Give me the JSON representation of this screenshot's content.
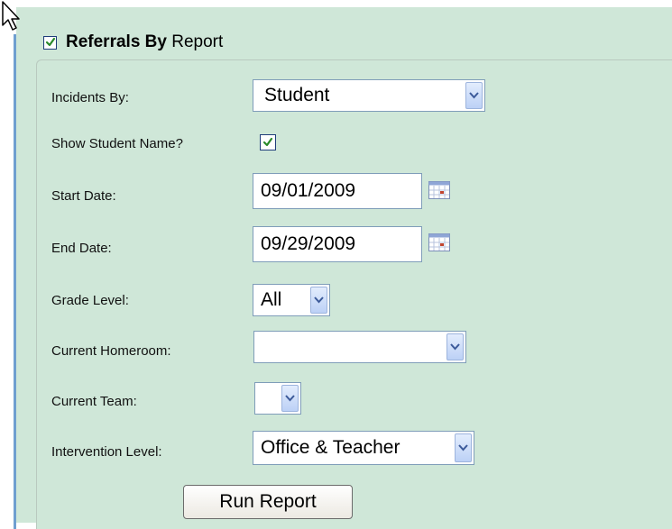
{
  "header": {
    "title_bold": "Referrals By",
    "title_rest": " Report",
    "enabled": true
  },
  "form": {
    "incidents_by": {
      "label": "Incidents By:",
      "value": "Student"
    },
    "show_student_name": {
      "label": "Show Student Name?",
      "checked": true
    },
    "start_date": {
      "label": "Start Date:",
      "value": "09/01/2009"
    },
    "end_date": {
      "label": "End Date:",
      "value": "09/29/2009"
    },
    "grade_level": {
      "label": "Grade Level:",
      "value": "All"
    },
    "current_homeroom": {
      "label": "Current Homeroom:",
      "value": ""
    },
    "current_team": {
      "label": "Current Team:",
      "value": ""
    },
    "intervention_level": {
      "label": "Intervention Level:",
      "value": "Office & Teacher"
    }
  },
  "actions": {
    "run_report": "Run Report"
  },
  "colors": {
    "panel_bg": "#cfe7d8",
    "accent": "#6f9fd0",
    "check": "#2a8a2a"
  }
}
